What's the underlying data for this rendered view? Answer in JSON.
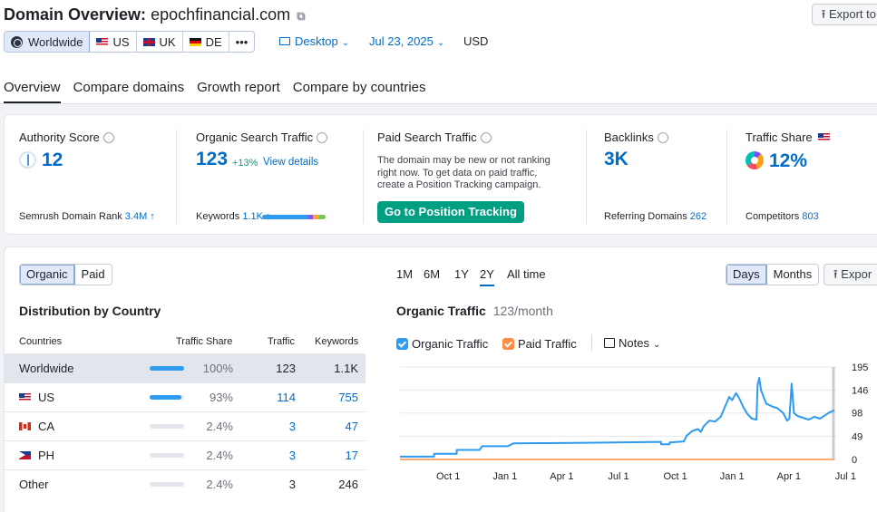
{
  "header": {
    "title_prefix": "Domain Overview:",
    "domain": "epochfinancial.com",
    "export_label": "Export to"
  },
  "db_selector": {
    "worldwide": "Worldwide",
    "countries": [
      "US",
      "UK",
      "DE"
    ],
    "more": "•••"
  },
  "controls": {
    "device": "Desktop",
    "date": "Jul 23, 2025",
    "currency": "USD"
  },
  "tabs": [
    "Overview",
    "Compare domains",
    "Growth report",
    "Compare by countries"
  ],
  "metrics": {
    "authority": {
      "label": "Authority Score",
      "value": "12",
      "rank_label": "Semrush Domain Rank",
      "rank_value": "3.4M ↑"
    },
    "organic": {
      "label": "Organic Search Traffic",
      "value": "123",
      "change": "+13%",
      "link": "View details",
      "keywords_label": "Keywords",
      "keywords_value": "1.1K ↑"
    },
    "paid": {
      "label": "Paid Search Traffic",
      "note": "The domain may be new or not ranking right now. To get data on paid traffic, create a Position Tracking campaign.",
      "button": "Go to Position Tracking"
    },
    "backlinks": {
      "label": "Backlinks",
      "value": "3K",
      "ref_label": "Referring Domains",
      "ref_value": "262"
    },
    "share": {
      "label": "Traffic Share",
      "value": "12%",
      "comp_label": "Competitors",
      "comp_value": "803"
    }
  },
  "distribution": {
    "toggle": [
      "Organic",
      "Paid"
    ],
    "title": "Distribution by Country",
    "headers": [
      "Countries",
      "Traffic Share",
      "Traffic",
      "Keywords"
    ],
    "rows": [
      {
        "country": "Worldwide",
        "share": "100%",
        "share_frac": 1.0,
        "traffic": "123",
        "keywords": "1.1K"
      },
      {
        "country": "US",
        "share": "93%",
        "share_frac": 0.93,
        "traffic": "114",
        "keywords": "755"
      },
      {
        "country": "CA",
        "share": "2.4%",
        "share_frac": 0.024,
        "traffic": "3",
        "keywords": "47"
      },
      {
        "country": "PH",
        "share": "2.4%",
        "share_frac": 0.024,
        "traffic": "3",
        "keywords": "17"
      },
      {
        "country": "Other",
        "share": "2.4%",
        "share_frac": 0.024,
        "traffic": "3",
        "keywords": "246"
      }
    ]
  },
  "traffic_panel": {
    "periods": [
      "1M",
      "6M",
      "1Y",
      "2Y",
      "All time"
    ],
    "active_period": "2Y",
    "granularity": [
      "Days",
      "Months"
    ],
    "export_label": "Expor",
    "title": "Organic Traffic",
    "subtitle": "123/month",
    "legend": [
      "Organic Traffic",
      "Paid Traffic"
    ],
    "notes_label": "Notes"
  },
  "colors": {
    "accent": "#006dca",
    "organic": "#2d9bef",
    "paid": "#ff8c42",
    "green": "#009f81"
  },
  "chart_data": {
    "type": "line",
    "x_ticks": [
      "Oct 1",
      "Jan 1",
      "Apr 1",
      "Jul 1",
      "Oct 1",
      "Jan 1",
      "Apr 1",
      "Jul 1"
    ],
    "y_ticks": [
      195,
      146,
      98,
      49,
      0
    ],
    "ylim": [
      0,
      195
    ],
    "grid": true,
    "series": [
      {
        "name": "Organic Traffic",
        "points": [
          [
            0,
            6
          ],
          [
            0.6,
            6
          ],
          [
            0.6,
            12
          ],
          [
            1.0,
            12
          ],
          [
            1.0,
            20
          ],
          [
            1.4,
            20
          ],
          [
            1.45,
            28
          ],
          [
            1.9,
            28
          ],
          [
            2.0,
            34
          ],
          [
            3.1,
            35
          ],
          [
            3.8,
            36
          ],
          [
            4.6,
            37
          ],
          [
            4.6,
            32
          ],
          [
            4.75,
            32
          ],
          [
            4.75,
            36
          ],
          [
            5.0,
            38
          ],
          [
            5.05,
            50
          ],
          [
            5.15,
            60
          ],
          [
            5.25,
            64
          ],
          [
            5.3,
            58
          ],
          [
            5.35,
            70
          ],
          [
            5.45,
            82
          ],
          [
            5.55,
            80
          ],
          [
            5.65,
            90
          ],
          [
            5.72,
            110
          ],
          [
            5.8,
            132
          ],
          [
            5.85,
            125
          ],
          [
            5.92,
            140
          ],
          [
            5.98,
            128
          ],
          [
            6.05,
            110
          ],
          [
            6.12,
            96
          ],
          [
            6.2,
            86
          ],
          [
            6.28,
            84
          ],
          [
            6.3,
            158
          ],
          [
            6.33,
            172
          ],
          [
            6.36,
            146
          ],
          [
            6.45,
            118
          ],
          [
            6.55,
            112
          ],
          [
            6.65,
            108
          ],
          [
            6.75,
            98
          ],
          [
            6.82,
            82
          ],
          [
            6.86,
            86
          ],
          [
            6.9,
            160
          ],
          [
            6.94,
            98
          ],
          [
            7.0,
            92
          ],
          [
            7.1,
            88
          ],
          [
            7.2,
            84
          ],
          [
            7.3,
            90
          ],
          [
            7.4,
            86
          ],
          [
            7.55,
            98
          ],
          [
            7.65,
            104
          ]
        ]
      },
      {
        "name": "Paid Traffic",
        "points": [
          [
            0,
            0
          ],
          [
            7.65,
            0
          ]
        ]
      }
    ]
  }
}
